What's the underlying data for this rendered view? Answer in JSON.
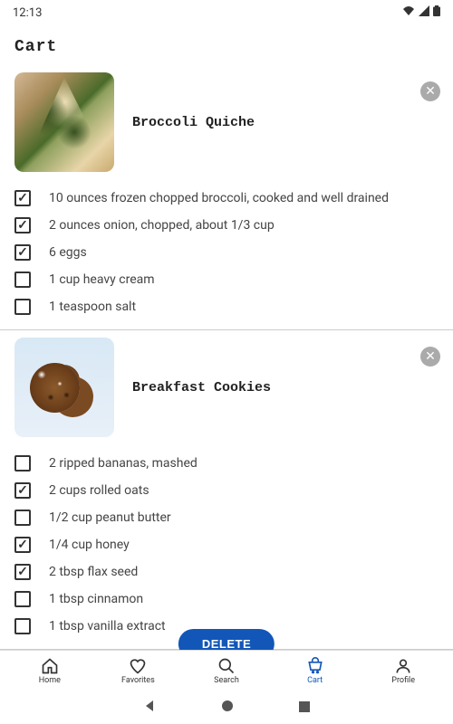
{
  "status": {
    "time": "12:13"
  },
  "page_title": "Cart",
  "recipes": [
    {
      "title": "Broccoli Quiche",
      "img_class": "quiche",
      "ingredients": [
        {
          "checked": true,
          "text": "10 ounces frozen chopped broccoli, cooked and well drained"
        },
        {
          "checked": true,
          "text": "2 ounces onion, chopped, about 1/3 cup"
        },
        {
          "checked": true,
          "text": "6 eggs"
        },
        {
          "checked": false,
          "text": "1 cup heavy cream"
        },
        {
          "checked": false,
          "text": "1 teaspoon salt"
        }
      ]
    },
    {
      "title": "Breakfast Cookies",
      "img_class": "cookies",
      "ingredients": [
        {
          "checked": false,
          "text": "2 ripped bananas, mashed"
        },
        {
          "checked": true,
          "text": "2 cups rolled oats"
        },
        {
          "checked": false,
          "text": "1/2 cup peanut butter"
        },
        {
          "checked": true,
          "text": "1/4 cup honey"
        },
        {
          "checked": true,
          "text": "2 tbsp flax seed"
        },
        {
          "checked": false,
          "text": "1 tbsp cinnamon"
        },
        {
          "checked": false,
          "text": "1 tbsp vanilla extract"
        }
      ]
    }
  ],
  "delete_label": "DELETE",
  "nav": [
    {
      "key": "home",
      "label": "Home",
      "active": false
    },
    {
      "key": "favorites",
      "label": "Favorites",
      "active": false
    },
    {
      "key": "search",
      "label": "Search",
      "active": false
    },
    {
      "key": "cart",
      "label": "Cart",
      "active": true
    },
    {
      "key": "profile",
      "label": "Profile",
      "active": false
    }
  ]
}
